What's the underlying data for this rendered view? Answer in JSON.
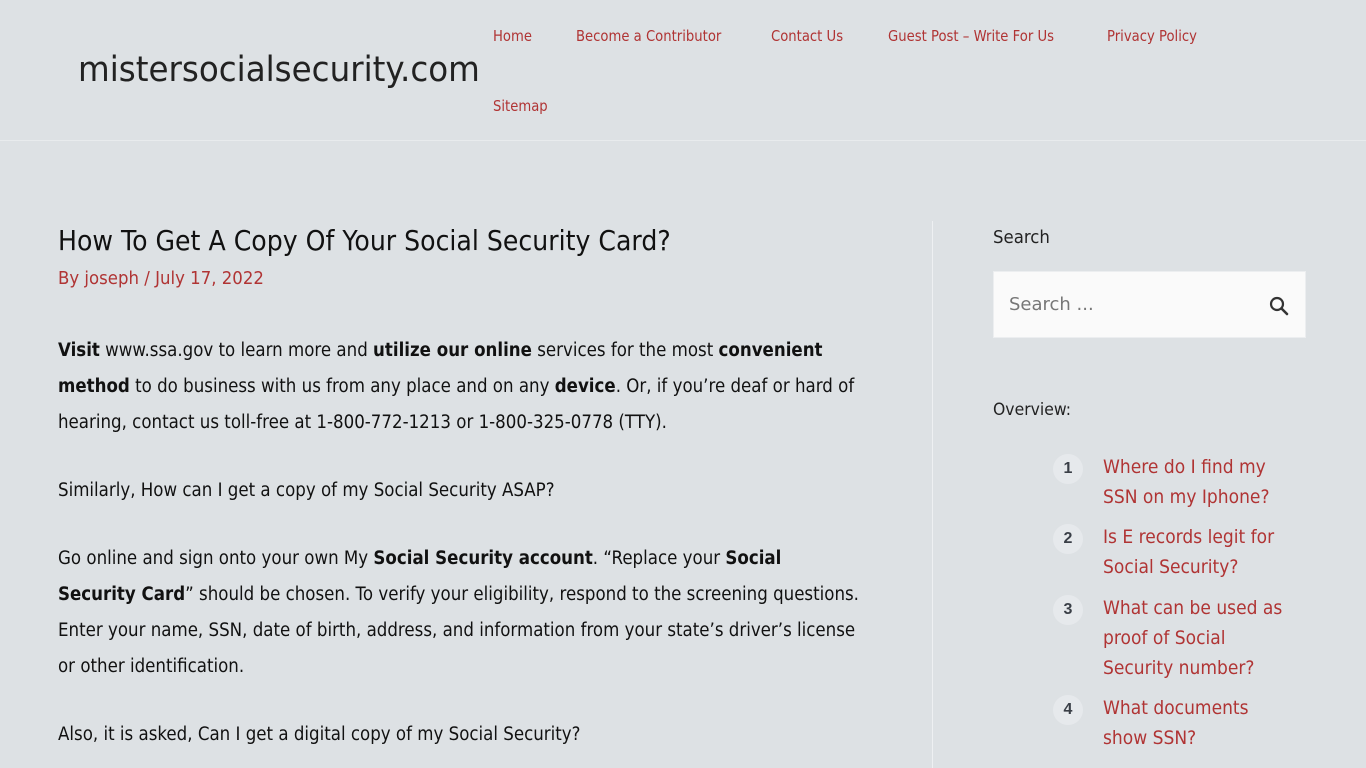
{
  "site": {
    "title": "mistersocialsecurity.com"
  },
  "nav": {
    "items": [
      {
        "label": "Home"
      },
      {
        "label": "Become a Contributor"
      },
      {
        "label": "Contact Us"
      },
      {
        "label": "Guest Post – Write For Us"
      },
      {
        "label": "Privacy Policy"
      },
      {
        "label": "Sitemap"
      }
    ]
  },
  "post": {
    "title": "How To Get A Copy Of Your Social Security Card?",
    "meta": {
      "by": "By ",
      "author": "joseph",
      "separator": " / ",
      "date": "July 17, 2022"
    },
    "paragraphs": {
      "p1": [
        {
          "t": "Visit",
          "b": true
        },
        {
          "t": " www.ssa.gov to learn more and ",
          "b": false
        },
        {
          "t": "utilize our online",
          "b": true
        },
        {
          "t": " services for the most ",
          "b": false
        },
        {
          "t": "convenient method",
          "b": true
        },
        {
          "t": " to do business with us from any place and on any ",
          "b": false
        },
        {
          "t": "device",
          "b": true
        },
        {
          "t": ". Or, if you’re deaf or hard of hearing, contact us toll-free at 1-800-772-1213 or 1-800-325-0778 (TTY).",
          "b": false
        }
      ],
      "p2": "Similarly, How can I get a copy of my Social Security ASAP?",
      "p3": [
        {
          "t": "Go online and sign onto your own My ",
          "b": false
        },
        {
          "t": "Social Security account",
          "b": true
        },
        {
          "t": ". “Replace your ",
          "b": false
        },
        {
          "t": "Social Security Card",
          "b": true
        },
        {
          "t": "” should be chosen. To verify your eligibility, respond to the screening questions. Enter your name, SSN, date of birth, address, and information from your state’s driver’s license or other identification.",
          "b": false
        }
      ],
      "p4": "Also, it is asked, Can I get a digital copy of my Social Security?"
    }
  },
  "sidebar": {
    "search_title": "Search",
    "search_placeholder": "Search ...",
    "search_icon": "search-icon",
    "overview_title": "Overview:",
    "toc": [
      {
        "num": "1",
        "label": "Where do I find my SSN on my Iphone?"
      },
      {
        "num": "2",
        "label": "Is E records legit for Social Security?"
      },
      {
        "num": "3",
        "label": "What can be used as proof of Social Security number?"
      },
      {
        "num": "4",
        "label": "What documents show SSN?"
      }
    ]
  },
  "colors": {
    "background": "#dde1e4",
    "link": "#b03434",
    "text": "#111111"
  }
}
